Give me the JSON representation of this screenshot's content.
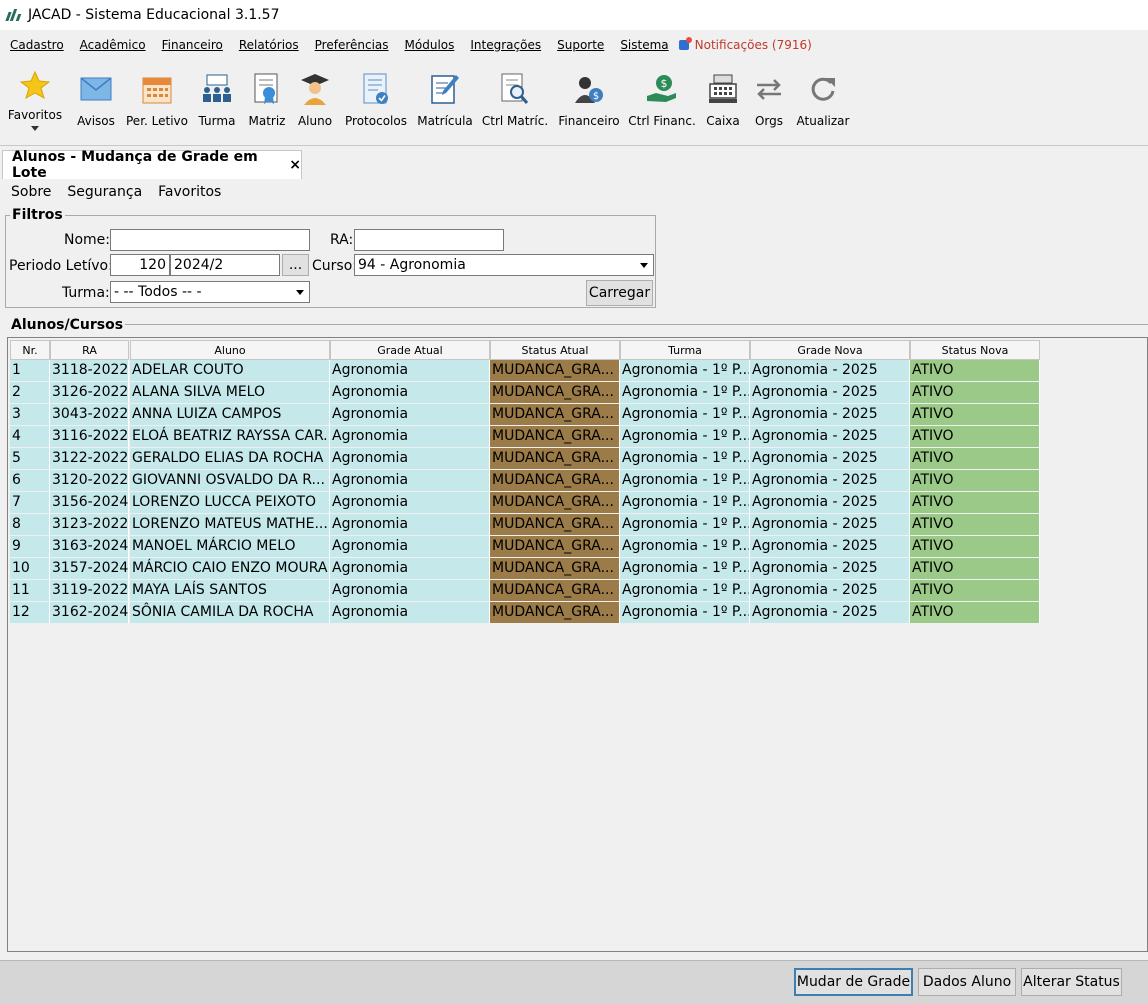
{
  "window": {
    "title": "JACAD - Sistema Educacional 3.1.57"
  },
  "menu": {
    "items": [
      "Cadastro",
      "Acadêmico",
      "Financeiro",
      "Relatórios",
      "Preferências",
      "Módulos",
      "Integrações",
      "Suporte",
      "Sistema"
    ],
    "notifications": "Notificações (7916)"
  },
  "toolbar": {
    "items": [
      {
        "label": "Favoritos",
        "icon": "star-icon"
      },
      {
        "label": "Avisos",
        "icon": "envelope-icon"
      },
      {
        "label": "Per. Letivo",
        "icon": "calendar-icon"
      },
      {
        "label": "Turma",
        "icon": "class-group-icon"
      },
      {
        "label": "Matriz",
        "icon": "certificate-icon"
      },
      {
        "label": "Aluno",
        "icon": "graduate-icon"
      },
      {
        "label": "Protocolos",
        "icon": "protocol-document-icon"
      },
      {
        "label": "Matrícula",
        "icon": "enrollment-edit-icon"
      },
      {
        "label": "Ctrl Matríc.",
        "icon": "document-search-icon"
      },
      {
        "label": "Financeiro",
        "icon": "person-money-icon"
      },
      {
        "label": "Ctrl Financ.",
        "icon": "money-hand-icon"
      },
      {
        "label": "Caixa",
        "icon": "cash-register-icon"
      },
      {
        "label": "Orgs",
        "icon": "swap-arrows-icon"
      },
      {
        "label": "Atualizar",
        "icon": "refresh-icon"
      }
    ]
  },
  "tab": {
    "title": "Alunos - Mudança de Grade em Lote",
    "close": "×"
  },
  "submenu": [
    "Sobre",
    "Segurança",
    "Favoritos"
  ],
  "filtros": {
    "legend": "Filtros",
    "nome_label": "Nome:",
    "nome_value": "",
    "ra_label": "RA:",
    "ra_value": "",
    "periodo_label": "Periodo Letívo:",
    "periodo_code": "120",
    "periodo_value": "2024/2",
    "ellipsis": "...",
    "curso_label": "Curso:",
    "curso_value": "94 - Agronomia",
    "turma_label": "Turma:",
    "turma_value": "- -- Todos -- -",
    "carregar": "Carregar"
  },
  "alunos": {
    "legend": "Alunos/Cursos",
    "columns": [
      "Nr.",
      "RA",
      "Aluno",
      "Grade Atual",
      "Status Atual",
      "Turma",
      "Grade Nova",
      "Status Nova"
    ],
    "rows": [
      [
        "1",
        "3118-2022",
        "ADELAR COUTO",
        "Agronomia",
        "MUDANCA_GRA...",
        "Agronomia - 1º P...",
        "Agronomia - 2025",
        "ATIVO"
      ],
      [
        "2",
        "3126-2022",
        "ALANA SILVA MELO",
        "Agronomia",
        "MUDANCA_GRA...",
        "Agronomia - 1º P...",
        "Agronomia - 2025",
        "ATIVO"
      ],
      [
        "3",
        "3043-2022",
        "ANNA LUIZA CAMPOS",
        "Agronomia",
        "MUDANCA_GRA...",
        "Agronomia - 1º P...",
        "Agronomia - 2025",
        "ATIVO"
      ],
      [
        "4",
        "3116-2022",
        "ELOÁ BEATRIZ RAYSSA CAR...",
        "Agronomia",
        "MUDANCA_GRA...",
        "Agronomia - 1º P...",
        "Agronomia - 2025",
        "ATIVO"
      ],
      [
        "5",
        "3122-2022",
        "GERALDO ELIAS DA ROCHA",
        "Agronomia",
        "MUDANCA_GRA...",
        "Agronomia - 1º P...",
        "Agronomia - 2025",
        "ATIVO"
      ],
      [
        "6",
        "3120-2022",
        "GIOVANNI OSVALDO DA R...",
        "Agronomia",
        "MUDANCA_GRA...",
        "Agronomia - 1º P...",
        "Agronomia - 2025",
        "ATIVO"
      ],
      [
        "7",
        "3156-2024",
        "LORENZO LUCCA PEIXOTO",
        "Agronomia",
        "MUDANCA_GRA...",
        "Agronomia - 1º P...",
        "Agronomia - 2025",
        "ATIVO"
      ],
      [
        "8",
        "3123-2022",
        "LORENZO MATEUS MATHE...",
        "Agronomia",
        "MUDANCA_GRA...",
        "Agronomia - 1º P...",
        "Agronomia - 2025",
        "ATIVO"
      ],
      [
        "9",
        "3163-2024",
        "MANOEL MÁRCIO MELO",
        "Agronomia",
        "MUDANCA_GRA...",
        "Agronomia - 1º P...",
        "Agronomia - 2025",
        "ATIVO"
      ],
      [
        "10",
        "3157-2024",
        "MÁRCIO CAIO ENZO MOURA",
        "Agronomia",
        "MUDANCA_GRA...",
        "Agronomia - 1º P...",
        "Agronomia - 2025",
        "ATIVO"
      ],
      [
        "11",
        "3119-2022",
        "MAYA LAÍS SANTOS",
        "Agronomia",
        "MUDANCA_GRA...",
        "Agronomia - 1º P...",
        "Agronomia - 2025",
        "ATIVO"
      ],
      [
        "12",
        "3162-2024",
        "SÔNIA CAMILA DA ROCHA",
        "Agronomia",
        "MUDANCA_GRA...",
        "Agronomia - 1º P...",
        "Agronomia - 2025",
        "ATIVO"
      ]
    ]
  },
  "footer": {
    "mudar": "Mudar de Grade",
    "dados": "Dados Aluno",
    "alterar": "Alterar Status"
  },
  "colors": {
    "teal": "#c5e8ea",
    "brown": "#9b7b47",
    "green": "#9bc987",
    "notif": "#c0392b"
  }
}
